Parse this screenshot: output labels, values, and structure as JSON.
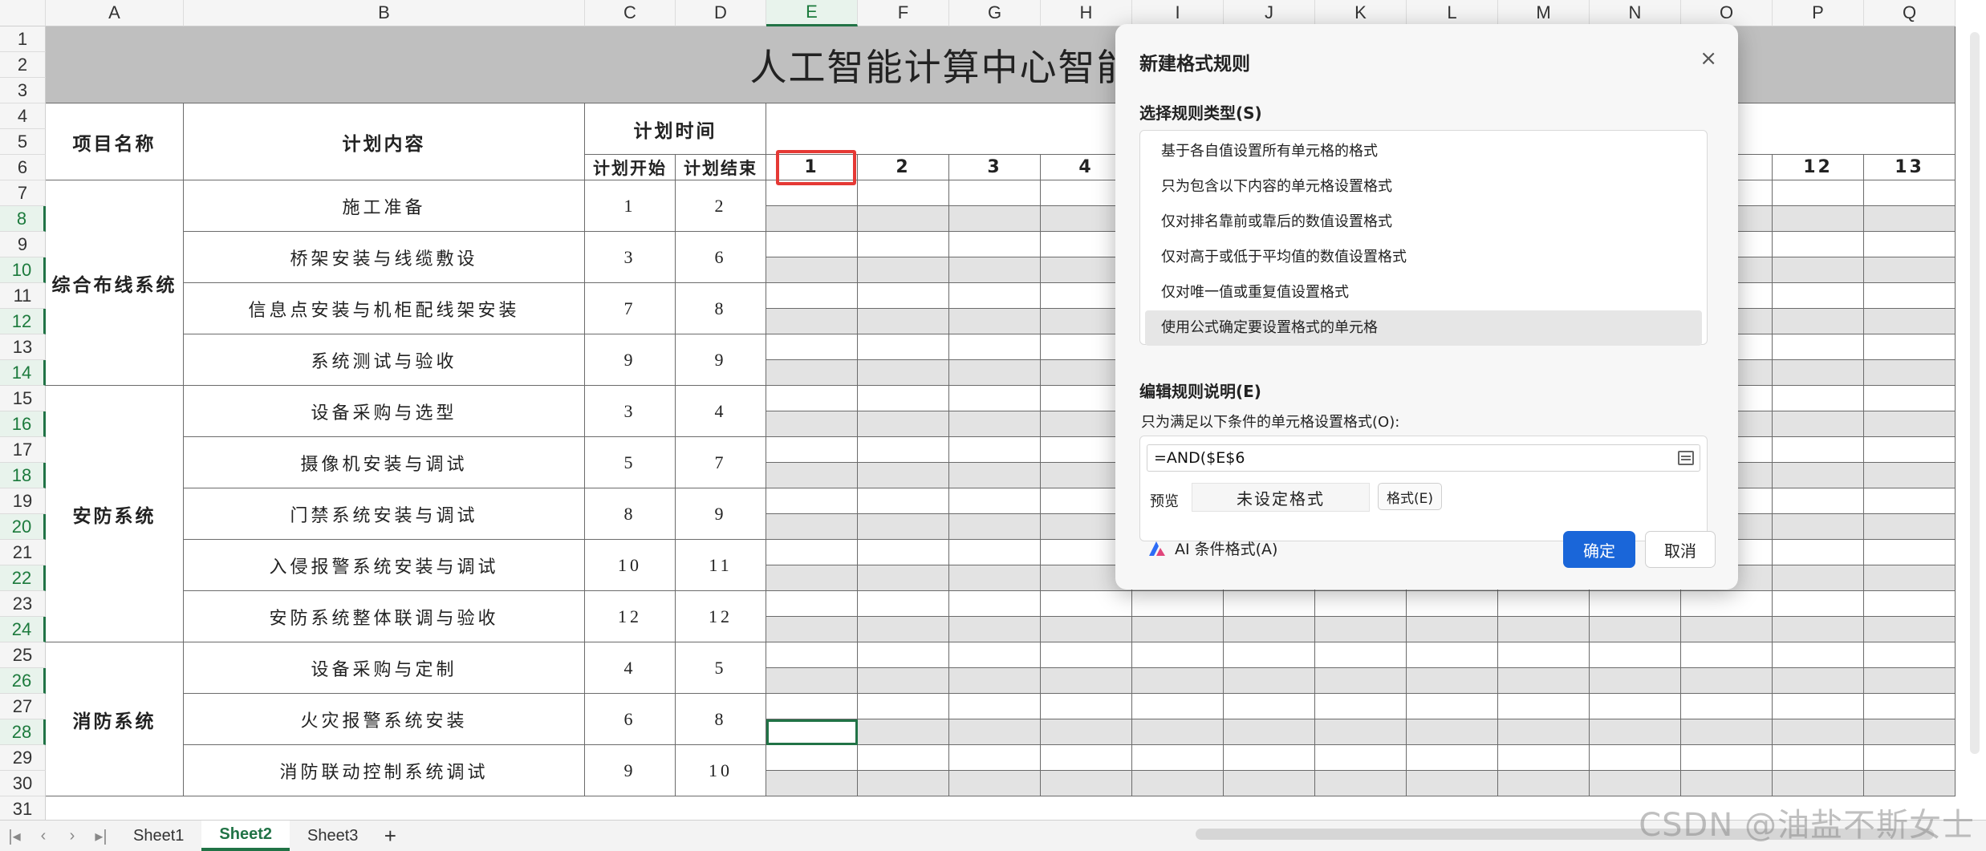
{
  "columns": [
    "A",
    "B",
    "C",
    "D",
    "E",
    "F",
    "G",
    "H",
    "I",
    "J",
    "K",
    "L",
    "M",
    "N",
    "O",
    "P",
    "Q"
  ],
  "rows": [
    "1",
    "2",
    "3",
    "4",
    "5",
    "6",
    "7",
    "8",
    "9",
    "10",
    "11",
    "12",
    "13",
    "14",
    "15",
    "16",
    "17",
    "18",
    "19",
    "20",
    "21",
    "22",
    "23",
    "24",
    "25",
    "26",
    "27",
    "28",
    "29",
    "30",
    "31"
  ],
  "sheet": {
    "title": "人工智能计算中心智能化系统",
    "header_project": "项目名称",
    "header_content": "计划内容",
    "header_time": "计划时间",
    "header_start": "计划开始",
    "header_end": "计划结束",
    "day_numbers": [
      "1",
      "2",
      "3",
      "4",
      "12",
      "13"
    ],
    "groups": [
      {
        "name": "综合布线系统",
        "tasks": [
          {
            "name": "施工准备",
            "start": "1",
            "end": "2"
          },
          {
            "name": "桥架安装与线缆敷设",
            "start": "3",
            "end": "6"
          },
          {
            "name": "信息点安装与机柜配线架安装",
            "start": "7",
            "end": "8"
          },
          {
            "name": "系统测试与验收",
            "start": "9",
            "end": "9"
          }
        ]
      },
      {
        "name": "安防系统",
        "tasks": [
          {
            "name": "设备采购与选型",
            "start": "3",
            "end": "4"
          },
          {
            "name": "摄像机安装与调试",
            "start": "5",
            "end": "7"
          },
          {
            "name": "门禁系统安装与调试",
            "start": "8",
            "end": "9"
          },
          {
            "name": "入侵报警系统安装与调试",
            "start": "10",
            "end": "11"
          },
          {
            "name": "安防系统整体联调与验收",
            "start": "12",
            "end": "12"
          }
        ]
      },
      {
        "name": "消防系统",
        "tasks": [
          {
            "name": "设备采购与定制",
            "start": "4",
            "end": "5"
          },
          {
            "name": "火灾报警系统安装",
            "start": "6",
            "end": "8"
          },
          {
            "name": "消防联动控制系统调试",
            "start": "9",
            "end": "10"
          }
        ]
      }
    ]
  },
  "dialog": {
    "title": "新建格式规则",
    "close": "×",
    "select_type_label": "选择规则类型(S)",
    "rule_types": [
      "基于各自值设置所有单元格的格式",
      "只为包含以下内容的单元格设置格式",
      "仅对排名靠前或靠后的数值设置格式",
      "仅对高于或低于平均值的数值设置格式",
      "仅对唯一值或重复值设置格式",
      "使用公式确定要设置格式的单元格"
    ],
    "edit_label": "编辑规则说明(E)",
    "condition_label": "只为满足以下条件的单元格设置格式(O):",
    "formula": "=AND($E$6",
    "preview_label": "预览",
    "preview_text": "未设定格式",
    "format_button": "格式(E)",
    "ai_button": "AI 条件格式(A)",
    "ok": "确定",
    "cancel": "取消"
  },
  "tabs": [
    "Sheet1",
    "Sheet2",
    "Sheet3"
  ],
  "add_tab": "+",
  "watermark": "CSDN @油盐不斯女士"
}
